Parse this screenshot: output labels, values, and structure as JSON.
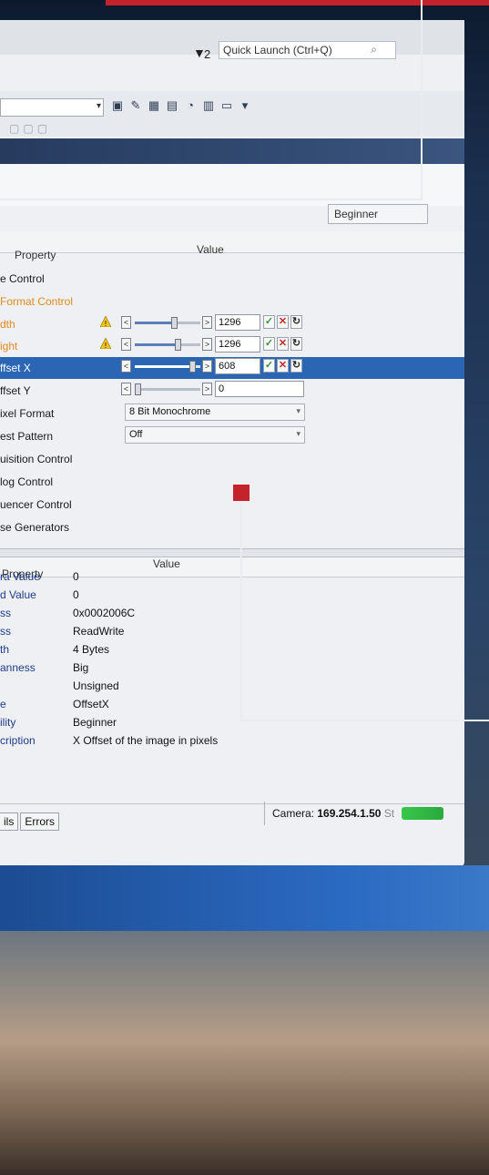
{
  "titlebar": {
    "filter_count": "2",
    "quick_launch_placeholder": "Quick Launch (Ctrl+Q)"
  },
  "toolbar": {
    "icons": [
      "window-icon",
      "wrench-icon",
      "calendar-icon",
      "folder-icon",
      "pie-chart-icon",
      "grid-icon",
      "monitor-icon",
      "dropdown-icon"
    ]
  },
  "visibility": {
    "selected": "Beginner"
  },
  "grid": {
    "headers": {
      "property": "Property",
      "value": "Value"
    },
    "rows": [
      {
        "label": "e Control",
        "style": "normal"
      },
      {
        "label": "Format Control",
        "style": "orange"
      },
      {
        "label": "dth",
        "style": "orange",
        "warning": true,
        "value": "1296",
        "slider": 0.6
      },
      {
        "label": "ight",
        "style": "orange",
        "warning": true,
        "value": "1296",
        "slider": 0.65
      },
      {
        "label": "ffset X",
        "style": "selected",
        "value": "608",
        "slider": 0.88
      },
      {
        "label": "ffset Y",
        "style": "normal",
        "value": "0",
        "slider": 0.0
      },
      {
        "label": "ixel Format",
        "style": "normal",
        "dropdown": "8 Bit Monochrome"
      },
      {
        "label": "est Pattern",
        "style": "normal",
        "dropdown": "Off"
      },
      {
        "label": "uisition Control",
        "style": "normal"
      },
      {
        "label": "log Control",
        "style": "normal"
      },
      {
        "label": "uencer Control",
        "style": "normal"
      },
      {
        "label": "se Generators",
        "style": "normal"
      }
    ]
  },
  "details": {
    "headers": {
      "property": "Property",
      "value": "Value"
    },
    "rows": [
      {
        "label": "ra Value",
        "value": "0"
      },
      {
        "label": "d Value",
        "value": "0"
      },
      {
        "label": "ss",
        "value": "0x0002006C"
      },
      {
        "label": "ss",
        "value": "ReadWrite"
      },
      {
        "label": "th",
        "value": "4 Bytes"
      },
      {
        "label": "anness",
        "value": "Big"
      },
      {
        "label": "",
        "value": "Unsigned"
      },
      {
        "label": "e",
        "value": "OffsetX"
      },
      {
        "label": "ility",
        "value": "Beginner"
      },
      {
        "label": "cription",
        "value": "X Offset of the image in pixels"
      }
    ]
  },
  "status": {
    "tabs": [
      "ils",
      "Errors"
    ],
    "camera_label": "Camera:",
    "camera_ip": "169.254.1.50",
    "camera_suffix": "St"
  },
  "colors": {
    "accent_red": "#c4232b",
    "selected_row": "#2a66b3",
    "ok_green": "#2d9a3a",
    "orange_label": "#e08a1e"
  }
}
